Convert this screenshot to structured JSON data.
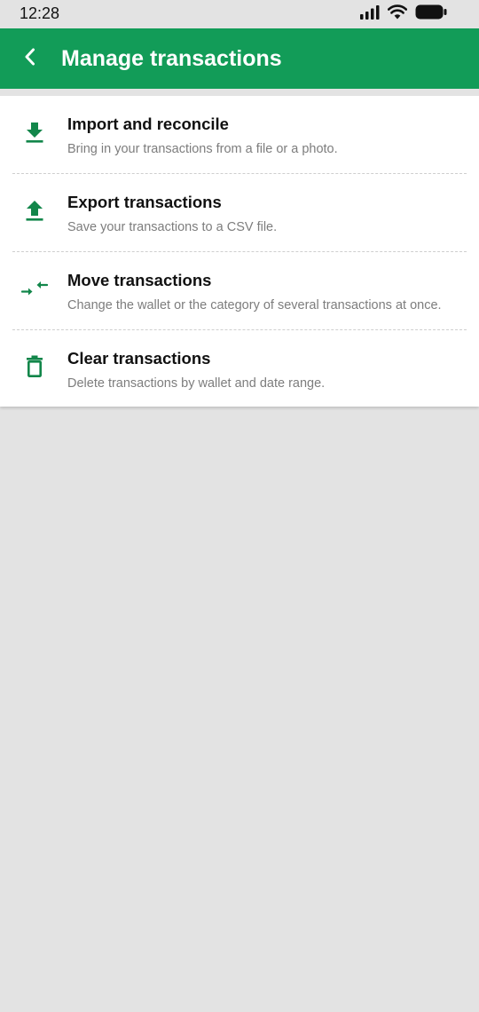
{
  "status_bar": {
    "time": "12:28"
  },
  "header": {
    "title": "Manage transactions",
    "back_icon": "chevron-left-icon"
  },
  "colors": {
    "brand": "#129c58",
    "icon": "#12864a",
    "background": "#e3e3e3",
    "card": "#ffffff",
    "subtitle": "#7d7d7d"
  },
  "menu": {
    "items": [
      {
        "icon": "download-icon",
        "title": "Import and reconcile",
        "subtitle": "Bring in your transactions from a file or a photo."
      },
      {
        "icon": "upload-icon",
        "title": "Export transactions",
        "subtitle": "Save your transactions to a CSV file."
      },
      {
        "icon": "move-arrows-icon",
        "title": "Move transactions",
        "subtitle": "Change the wallet or the category of several transactions at once."
      },
      {
        "icon": "trash-icon",
        "title": "Clear transactions",
        "subtitle": "Delete transactions by wallet and date range."
      }
    ]
  }
}
